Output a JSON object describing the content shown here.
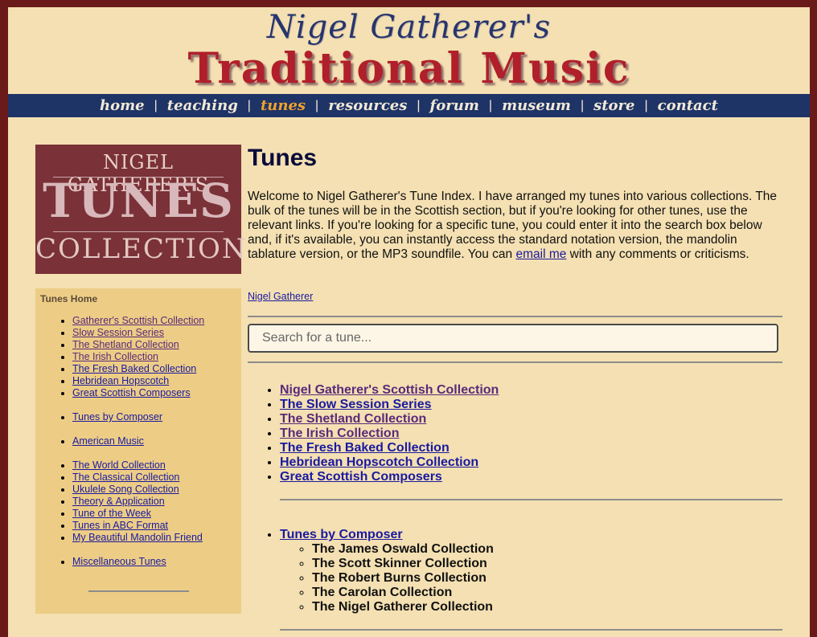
{
  "header": {
    "brand_top": "Nigel Gatherer's",
    "brand_main": "Traditional Music"
  },
  "nav": {
    "items": [
      {
        "label": "home"
      },
      {
        "label": "teaching"
      },
      {
        "label": "tunes"
      },
      {
        "label": "resources"
      },
      {
        "label": "forum"
      },
      {
        "label": "museum"
      },
      {
        "label": "store"
      },
      {
        "label": "contact"
      }
    ],
    "separator": "|",
    "active": "tunes",
    "active_color": "#f0a22c"
  },
  "logo": {
    "line1": "NIGEL GATHERER'S",
    "line2": "TUNES",
    "line3": "COLLECTION"
  },
  "sidebar": {
    "title": "Tunes Home",
    "groups": [
      [
        "Gatherer's Scottish Collection",
        "Slow Session Series",
        "The Shetland Collection",
        "The Irish Collection",
        "The Fresh Baked Collection",
        "Hebridean Hopscotch",
        "Great Scottish Composers"
      ],
      [
        "Tunes by Composer"
      ],
      [
        "American Music"
      ],
      [
        "The World Collection",
        "The Classical Collection",
        "Ukulele Song Collection",
        "Theory & Application",
        "Tune of the Week",
        "Tunes in ABC Format",
        "My Beautiful Mandolin Friend"
      ],
      [
        "Miscellaneous Tunes"
      ]
    ]
  },
  "main": {
    "title": "Tunes",
    "intro_before": "Welcome to Nigel Gatherer's Tune Index. I have arranged my tunes into various collections. The bulk of the tunes will be in the Scottish section, but if you're looking for other tunes, use the relevant links. If you're looking for a specific tune, you could enter it into the search box below and, if it's available, you can instantly access the standard notation version, the mandolin tablature version, or the MP3 soundfile. You can ",
    "intro_link": "email me",
    "intro_after": " with any comments or criticisms.",
    "author_link": "Nigel Gatherer",
    "search_placeholder": "Search for a tune...",
    "collections": [
      "Nigel Gatherer's Scottish Collection",
      "The Slow Session Series",
      "The Shetland Collection",
      "The Irish Collection",
      "The Fresh Baked Collection",
      "Hebridean Hopscotch Collection",
      "Great Scottish Composers"
    ],
    "composer_link": "Tunes by Composer",
    "composer_subs": [
      "The James Oswald Collection",
      "The Scott Skinner Collection",
      "The Robert Burns Collection",
      "The Carolan Collection",
      "The Nigel Gatherer Collection"
    ]
  },
  "colors": {
    "page_bg": "#f4e0b2",
    "frame": "#6b1a1a",
    "nav_bg": "#1e3366",
    "sidebar_bg": "#edcd85",
    "link": "#1a1aa0",
    "visited": "#5a2a7a"
  }
}
